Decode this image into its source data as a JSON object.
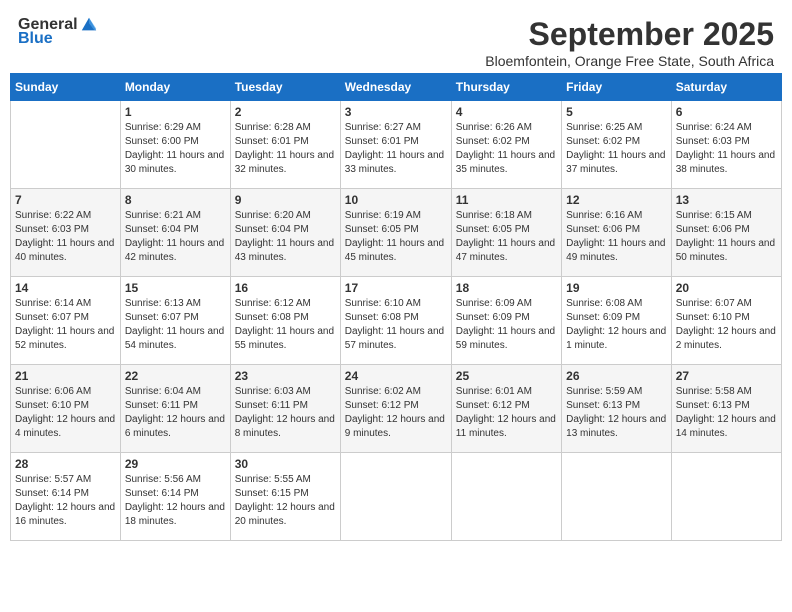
{
  "header": {
    "logo": {
      "text1": "General",
      "text2": "Blue"
    },
    "title": "September 2025",
    "subtitle": "Bloemfontein, Orange Free State, South Africa"
  },
  "weekdays": [
    "Sunday",
    "Monday",
    "Tuesday",
    "Wednesday",
    "Thursday",
    "Friday",
    "Saturday"
  ],
  "weeks": [
    [
      {
        "day": "",
        "sunrise": "",
        "sunset": "",
        "daylight": ""
      },
      {
        "day": "1",
        "sunrise": "Sunrise: 6:29 AM",
        "sunset": "Sunset: 6:00 PM",
        "daylight": "Daylight: 11 hours and 30 minutes."
      },
      {
        "day": "2",
        "sunrise": "Sunrise: 6:28 AM",
        "sunset": "Sunset: 6:01 PM",
        "daylight": "Daylight: 11 hours and 32 minutes."
      },
      {
        "day": "3",
        "sunrise": "Sunrise: 6:27 AM",
        "sunset": "Sunset: 6:01 PM",
        "daylight": "Daylight: 11 hours and 33 minutes."
      },
      {
        "day": "4",
        "sunrise": "Sunrise: 6:26 AM",
        "sunset": "Sunset: 6:02 PM",
        "daylight": "Daylight: 11 hours and 35 minutes."
      },
      {
        "day": "5",
        "sunrise": "Sunrise: 6:25 AM",
        "sunset": "Sunset: 6:02 PM",
        "daylight": "Daylight: 11 hours and 37 minutes."
      },
      {
        "day": "6",
        "sunrise": "Sunrise: 6:24 AM",
        "sunset": "Sunset: 6:03 PM",
        "daylight": "Daylight: 11 hours and 38 minutes."
      }
    ],
    [
      {
        "day": "7",
        "sunrise": "Sunrise: 6:22 AM",
        "sunset": "Sunset: 6:03 PM",
        "daylight": "Daylight: 11 hours and 40 minutes."
      },
      {
        "day": "8",
        "sunrise": "Sunrise: 6:21 AM",
        "sunset": "Sunset: 6:04 PM",
        "daylight": "Daylight: 11 hours and 42 minutes."
      },
      {
        "day": "9",
        "sunrise": "Sunrise: 6:20 AM",
        "sunset": "Sunset: 6:04 PM",
        "daylight": "Daylight: 11 hours and 43 minutes."
      },
      {
        "day": "10",
        "sunrise": "Sunrise: 6:19 AM",
        "sunset": "Sunset: 6:05 PM",
        "daylight": "Daylight: 11 hours and 45 minutes."
      },
      {
        "day": "11",
        "sunrise": "Sunrise: 6:18 AM",
        "sunset": "Sunset: 6:05 PM",
        "daylight": "Daylight: 11 hours and 47 minutes."
      },
      {
        "day": "12",
        "sunrise": "Sunrise: 6:16 AM",
        "sunset": "Sunset: 6:06 PM",
        "daylight": "Daylight: 11 hours and 49 minutes."
      },
      {
        "day": "13",
        "sunrise": "Sunrise: 6:15 AM",
        "sunset": "Sunset: 6:06 PM",
        "daylight": "Daylight: 11 hours and 50 minutes."
      }
    ],
    [
      {
        "day": "14",
        "sunrise": "Sunrise: 6:14 AM",
        "sunset": "Sunset: 6:07 PM",
        "daylight": "Daylight: 11 hours and 52 minutes."
      },
      {
        "day": "15",
        "sunrise": "Sunrise: 6:13 AM",
        "sunset": "Sunset: 6:07 PM",
        "daylight": "Daylight: 11 hours and 54 minutes."
      },
      {
        "day": "16",
        "sunrise": "Sunrise: 6:12 AM",
        "sunset": "Sunset: 6:08 PM",
        "daylight": "Daylight: 11 hours and 55 minutes."
      },
      {
        "day": "17",
        "sunrise": "Sunrise: 6:10 AM",
        "sunset": "Sunset: 6:08 PM",
        "daylight": "Daylight: 11 hours and 57 minutes."
      },
      {
        "day": "18",
        "sunrise": "Sunrise: 6:09 AM",
        "sunset": "Sunset: 6:09 PM",
        "daylight": "Daylight: 11 hours and 59 minutes."
      },
      {
        "day": "19",
        "sunrise": "Sunrise: 6:08 AM",
        "sunset": "Sunset: 6:09 PM",
        "daylight": "Daylight: 12 hours and 1 minute."
      },
      {
        "day": "20",
        "sunrise": "Sunrise: 6:07 AM",
        "sunset": "Sunset: 6:10 PM",
        "daylight": "Daylight: 12 hours and 2 minutes."
      }
    ],
    [
      {
        "day": "21",
        "sunrise": "Sunrise: 6:06 AM",
        "sunset": "Sunset: 6:10 PM",
        "daylight": "Daylight: 12 hours and 4 minutes."
      },
      {
        "day": "22",
        "sunrise": "Sunrise: 6:04 AM",
        "sunset": "Sunset: 6:11 PM",
        "daylight": "Daylight: 12 hours and 6 minutes."
      },
      {
        "day": "23",
        "sunrise": "Sunrise: 6:03 AM",
        "sunset": "Sunset: 6:11 PM",
        "daylight": "Daylight: 12 hours and 8 minutes."
      },
      {
        "day": "24",
        "sunrise": "Sunrise: 6:02 AM",
        "sunset": "Sunset: 6:12 PM",
        "daylight": "Daylight: 12 hours and 9 minutes."
      },
      {
        "day": "25",
        "sunrise": "Sunrise: 6:01 AM",
        "sunset": "Sunset: 6:12 PM",
        "daylight": "Daylight: 12 hours and 11 minutes."
      },
      {
        "day": "26",
        "sunrise": "Sunrise: 5:59 AM",
        "sunset": "Sunset: 6:13 PM",
        "daylight": "Daylight: 12 hours and 13 minutes."
      },
      {
        "day": "27",
        "sunrise": "Sunrise: 5:58 AM",
        "sunset": "Sunset: 6:13 PM",
        "daylight": "Daylight: 12 hours and 14 minutes."
      }
    ],
    [
      {
        "day": "28",
        "sunrise": "Sunrise: 5:57 AM",
        "sunset": "Sunset: 6:14 PM",
        "daylight": "Daylight: 12 hours and 16 minutes."
      },
      {
        "day": "29",
        "sunrise": "Sunrise: 5:56 AM",
        "sunset": "Sunset: 6:14 PM",
        "daylight": "Daylight: 12 hours and 18 minutes."
      },
      {
        "day": "30",
        "sunrise": "Sunrise: 5:55 AM",
        "sunset": "Sunset: 6:15 PM",
        "daylight": "Daylight: 12 hours and 20 minutes."
      },
      {
        "day": "",
        "sunrise": "",
        "sunset": "",
        "daylight": ""
      },
      {
        "day": "",
        "sunrise": "",
        "sunset": "",
        "daylight": ""
      },
      {
        "day": "",
        "sunrise": "",
        "sunset": "",
        "daylight": ""
      },
      {
        "day": "",
        "sunrise": "",
        "sunset": "",
        "daylight": ""
      }
    ]
  ]
}
